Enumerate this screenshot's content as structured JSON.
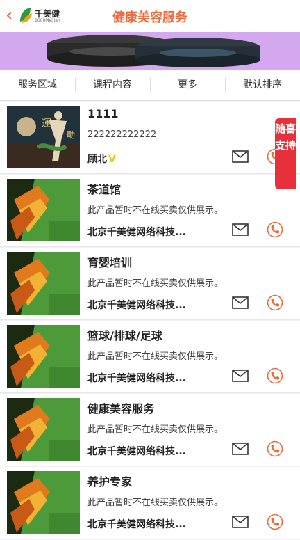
{
  "header": {
    "back_icon": "chevron-left-icon",
    "logo_text": "千美健",
    "logo_sub": "1000MeiJian",
    "title": "健康美容服务"
  },
  "filters": [
    "服务区域",
    "课程内容",
    "更多",
    "默认排序"
  ],
  "floating": {
    "support_label": "随喜支持"
  },
  "items": [
    {
      "name": "1111",
      "desc": "222222222222",
      "company": "顾北",
      "vip": "V"
    },
    {
      "name": "茶道馆",
      "desc": "此产品暂时不在线买卖仅供展示。",
      "company": "北京千美健网络科技..."
    },
    {
      "name": "育婴培训",
      "desc": "此产品暂时不在线买卖仅供展示。",
      "company": "北京千美健网络科技..."
    },
    {
      "name": "篮球/排球/足球",
      "desc": "此产品暂时不在线买卖仅供展示。",
      "company": "北京千美健网络科技..."
    },
    {
      "name": "健康美容服务",
      "desc": "此产品暂时不在线买卖仅供展示。",
      "company": "北京千美健网络科技..."
    },
    {
      "name": "养护专家",
      "desc": "此产品暂时不在线买卖仅供展示。",
      "company": "北京千美健网络科技..."
    }
  ],
  "colors": {
    "accent": "#ee6a3c",
    "support": "#e8303a",
    "banner": "#d4a8ef"
  }
}
